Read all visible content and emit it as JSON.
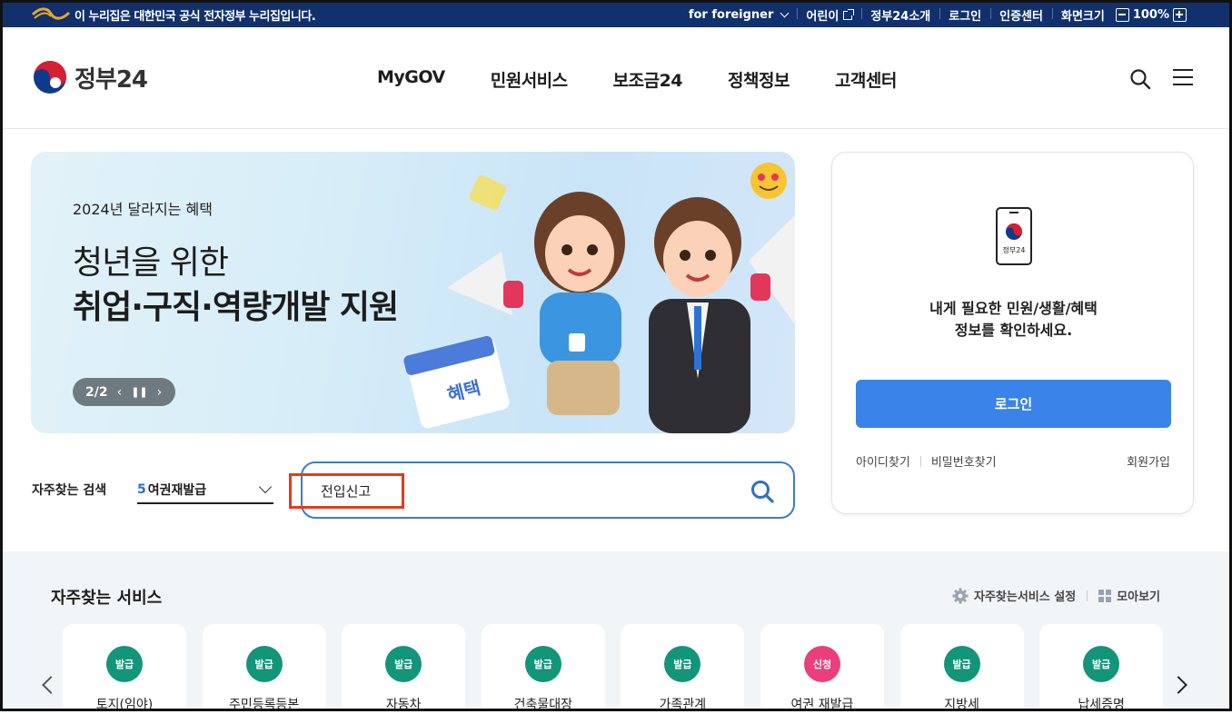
{
  "topbar": {
    "notice": "이 누리집은 대한민국 공식 전자정부 누리집입니다.",
    "foreigner": "for foreigner",
    "kids": "어린이",
    "about": "정부24소개",
    "login": "로그인",
    "cert": "인증센터",
    "screen_size": "화면크기",
    "zoom": "100%"
  },
  "header": {
    "logo": "정부24",
    "nav": [
      "MyGOV",
      "민원서비스",
      "보조금24",
      "정책정보",
      "고객센터"
    ]
  },
  "hero": {
    "kicker": "2024년 달라지는 혜택",
    "title_line1": "청년을 위한",
    "title_line2": "취업·구직·역량개발 지원",
    "pager": "2/2",
    "calendar_text": "혜택"
  },
  "login_card": {
    "phone_label": "정부24",
    "message_line1": "내게 필요한 민원/생활/혜택",
    "message_line2": "정보를 확인하세요.",
    "login_button": "로그인",
    "find_id": "아이디찾기",
    "find_pw": "비밀번호찾기",
    "join": "회원가입"
  },
  "frequent_search": {
    "label": "자주찾는 검색",
    "rank": "5",
    "selected": "여권재발급",
    "query": "전입신고"
  },
  "services": {
    "title": "자주찾는 서비스",
    "settings": "자주찾는서비스 설정",
    "view_all": "모아보기",
    "items": [
      {
        "badge": "발급",
        "label": "토지(임야)"
      },
      {
        "badge": "발급",
        "label": "주민등록등본"
      },
      {
        "badge": "발급",
        "label": "자동차"
      },
      {
        "badge": "발급",
        "label": "건축물대장"
      },
      {
        "badge": "발급",
        "label": "가족관계"
      },
      {
        "badge": "신청",
        "label": "여권 재발급"
      },
      {
        "badge": "발급",
        "label": "지방세"
      },
      {
        "badge": "발급",
        "label": "납세증명"
      }
    ]
  },
  "colors": {
    "topbar": "#11306c",
    "primary_button": "#3a83e8",
    "badge_issue": "#13957a",
    "badge_apply": "#ea3f7c",
    "highlight": "#e53a1f"
  }
}
